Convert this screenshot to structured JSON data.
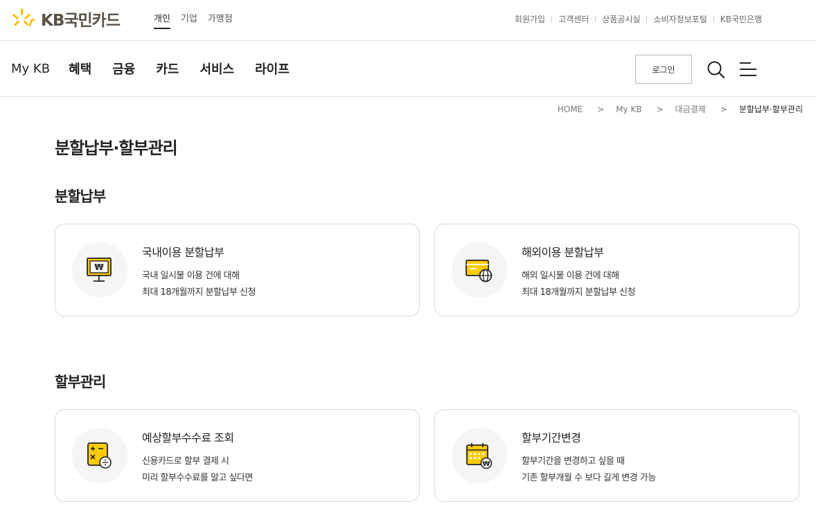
{
  "header": {
    "logo_text": "KB국민카드",
    "site_tabs": [
      "개인",
      "기업",
      "가맹점"
    ],
    "util_links": [
      "회원가입",
      "고객센터",
      "상품공시실",
      "소비자정보포털",
      "KB국민은행"
    ]
  },
  "nav": {
    "items": [
      "My KB",
      "혜택",
      "금융",
      "카드",
      "서비스",
      "라이프"
    ],
    "login_label": "로그인"
  },
  "breadcrumb": [
    "HOME",
    "My KB",
    "대금결제",
    "분할납부·할부관리"
  ],
  "breadcrumb_sep": ">",
  "page": {
    "title": "분할납부·할부관리",
    "sections": [
      {
        "title": "분할납부",
        "cards": [
          {
            "title": "국내이용 분할납부",
            "desc1": "국내 일시불 이용 건에 대해",
            "desc2": "최대 18개월까지 분할납부 신청",
            "icon": "monitor-won-icon"
          },
          {
            "title": "해외이용 분할납부",
            "desc1": "해외 일시불 이용 건에 대해",
            "desc2": "최대 18개월까지 분할납부 신청",
            "icon": "card-globe-icon"
          }
        ]
      },
      {
        "title": "할부관리",
        "cards": [
          {
            "title": "예상할부수수료 조회",
            "desc1": "신용카드로 할부 결제 시",
            "desc2": "미리 할부수수료를 알고 싶다면",
            "icon": "calculator-icon"
          },
          {
            "title": "할부기간변경",
            "desc1": "할부기간을 변경하고 싶을 때",
            "desc2": "기존 할부개월 수 보다 길게 변경 가능",
            "icon": "calendar-won-icon"
          }
        ]
      }
    ]
  },
  "colors": {
    "accent": "#ffcc00",
    "logo_text": "#5a5046",
    "card_border": "#d9d9d9",
    "icon_bg": "#f4f5f7"
  }
}
